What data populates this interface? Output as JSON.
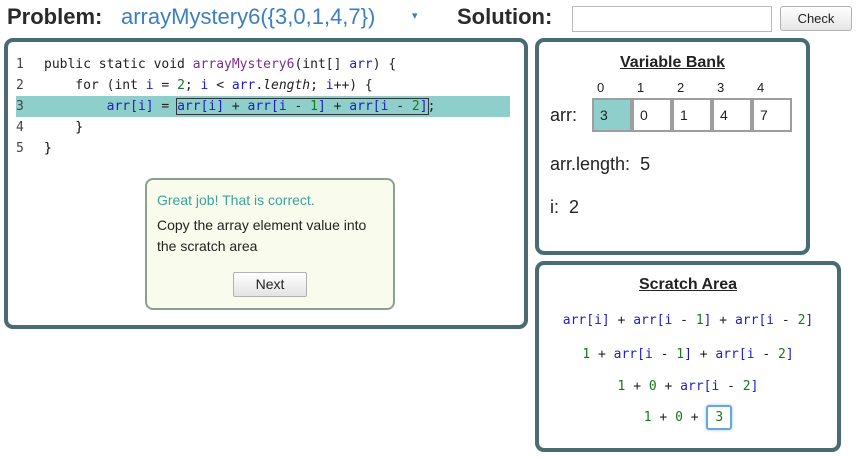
{
  "header": {
    "problem_label": "Problem:",
    "problem_name": "arrayMystery6({3,0,1,4,7})",
    "dropdown_caret": "▾",
    "solution_label": "Solution:",
    "solution_value": "",
    "check_label": "Check"
  },
  "code": {
    "line_numbers": [
      "1",
      "2",
      "3",
      "4",
      "5"
    ],
    "line1": {
      "kw1": "public static void ",
      "fn": "arrayMystery6",
      "p1": "(int[] ",
      "arg": "arr",
      "p2": ") {"
    },
    "line2": {
      "pre": "    for (int ",
      "i": "i",
      "eq": " = ",
      "n2": "2",
      "semi": "; ",
      "i2": "i",
      "lt": " < ",
      "arr": "arr",
      "dot": ".",
      "len": "length",
      "semi2": "; ",
      "i3": "i",
      "inc": "++) {"
    },
    "line3": {
      "pre": "        ",
      "a1": "arr",
      "b1": "[",
      "i1": "i",
      "b2": "]",
      "eq": " = ",
      "a2": "arr",
      "b3": "[",
      "i2": "i",
      "b4": "]",
      "plus1": " + ",
      "a3": "arr",
      "b5": "[",
      "i3": "i",
      "minus1": " - ",
      "one": "1",
      "b6": "]",
      "plus2": " + ",
      "a4": "arr",
      "b7": "[",
      "i4": "i",
      "minus2": " - ",
      "two": "2",
      "b8": "]",
      "semi": ";"
    },
    "line4": "    }",
    "line5": "}"
  },
  "feedback": {
    "title": "Great job! That is correct.",
    "text": "Copy the array element value into the scratch area",
    "next_label": "Next"
  },
  "variable_bank": {
    "title": "Variable Bank",
    "indices": [
      "0",
      "1",
      "2",
      "3",
      "4"
    ],
    "arr_label": "arr:",
    "values": [
      "3",
      "0",
      "1",
      "4",
      "7"
    ],
    "active_index": 0,
    "length_label": "arr.length:",
    "length_value": "5",
    "i_label": "i:",
    "i_value": "2"
  },
  "scratch": {
    "title": "Scratch Area",
    "line1": {
      "a1": "arr",
      "o1": "[",
      "i1": "i",
      "c1": "]",
      "p1": " + ",
      "a2": "arr",
      "o2": "[",
      "i2": "i",
      "m1": " - ",
      "n1": "1",
      "c2": "]",
      "p2": " + ",
      "a3": "arr",
      "o3": "[",
      "i3": "i",
      "m2": " - ",
      "n2": "2",
      "c3": "]"
    },
    "line2": {
      "n0": "1",
      "p1": " + ",
      "a2": "arr",
      "o2": "[",
      "i2": "i",
      "m1": " - ",
      "n1": "1",
      "c2": "]",
      "p2": " + ",
      "a3": "arr",
      "o3": "[",
      "i3": "i",
      "m2": " - ",
      "n2": "2",
      "c3": "]"
    },
    "line3": {
      "n0": "1",
      "p1": " + ",
      "n1": "0",
      "p2": " + ",
      "a3": "arr",
      "o3": "[",
      "i3": "i",
      "m2": " - ",
      "n2": "2",
      "c3": "]"
    },
    "line4": {
      "n0": "1",
      "p1": " + ",
      "n1": "0",
      "p2": " + ",
      "answer": "3"
    }
  },
  "colors": {
    "panel_border": "#496b73",
    "highlight": "#8fcfcb",
    "accent_blue": "#3c7fc0",
    "feedback_green": "#3ba39a"
  }
}
